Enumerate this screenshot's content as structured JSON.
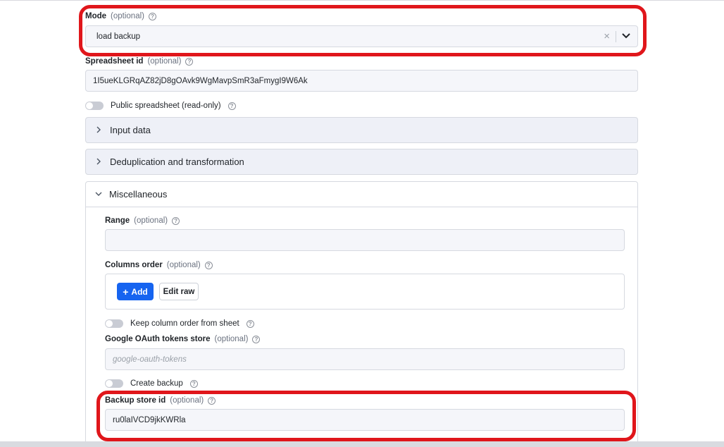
{
  "mode": {
    "label": "Mode",
    "optional": "(optional)",
    "value": "load backup",
    "clear_icon": "×"
  },
  "spreadsheet": {
    "label": "Spreadsheet id",
    "optional": "(optional)",
    "value": "1I5ueKLGRqAZ82jD8gOAvk9WgMavpSmR3aFmygI9W6Ak"
  },
  "public_toggle": {
    "label": "Public spreadsheet (read-only)"
  },
  "sections": {
    "input_data": "Input data",
    "dedup": "Deduplication and transformation",
    "misc": "Miscellaneous"
  },
  "range": {
    "label": "Range",
    "optional": "(optional)",
    "value": ""
  },
  "columns_order": {
    "label": "Columns order",
    "optional": "(optional)",
    "add_label": "Add",
    "add_icon": "+",
    "edit_raw_label": "Edit raw"
  },
  "keep_order_toggle": {
    "label": "Keep column order from sheet"
  },
  "oauth_store": {
    "label": "Google OAuth tokens store",
    "optional": "(optional)",
    "placeholder": "google-oauth-tokens"
  },
  "create_backup_toggle": {
    "label": "Create backup"
  },
  "backup_store": {
    "label": "Backup store id",
    "optional": "(optional)",
    "value": "ru0laIVCD9jkKWRla"
  },
  "help_glyph": "?",
  "colors": {
    "highlight": "#e0161b",
    "primary": "#1664f0"
  }
}
